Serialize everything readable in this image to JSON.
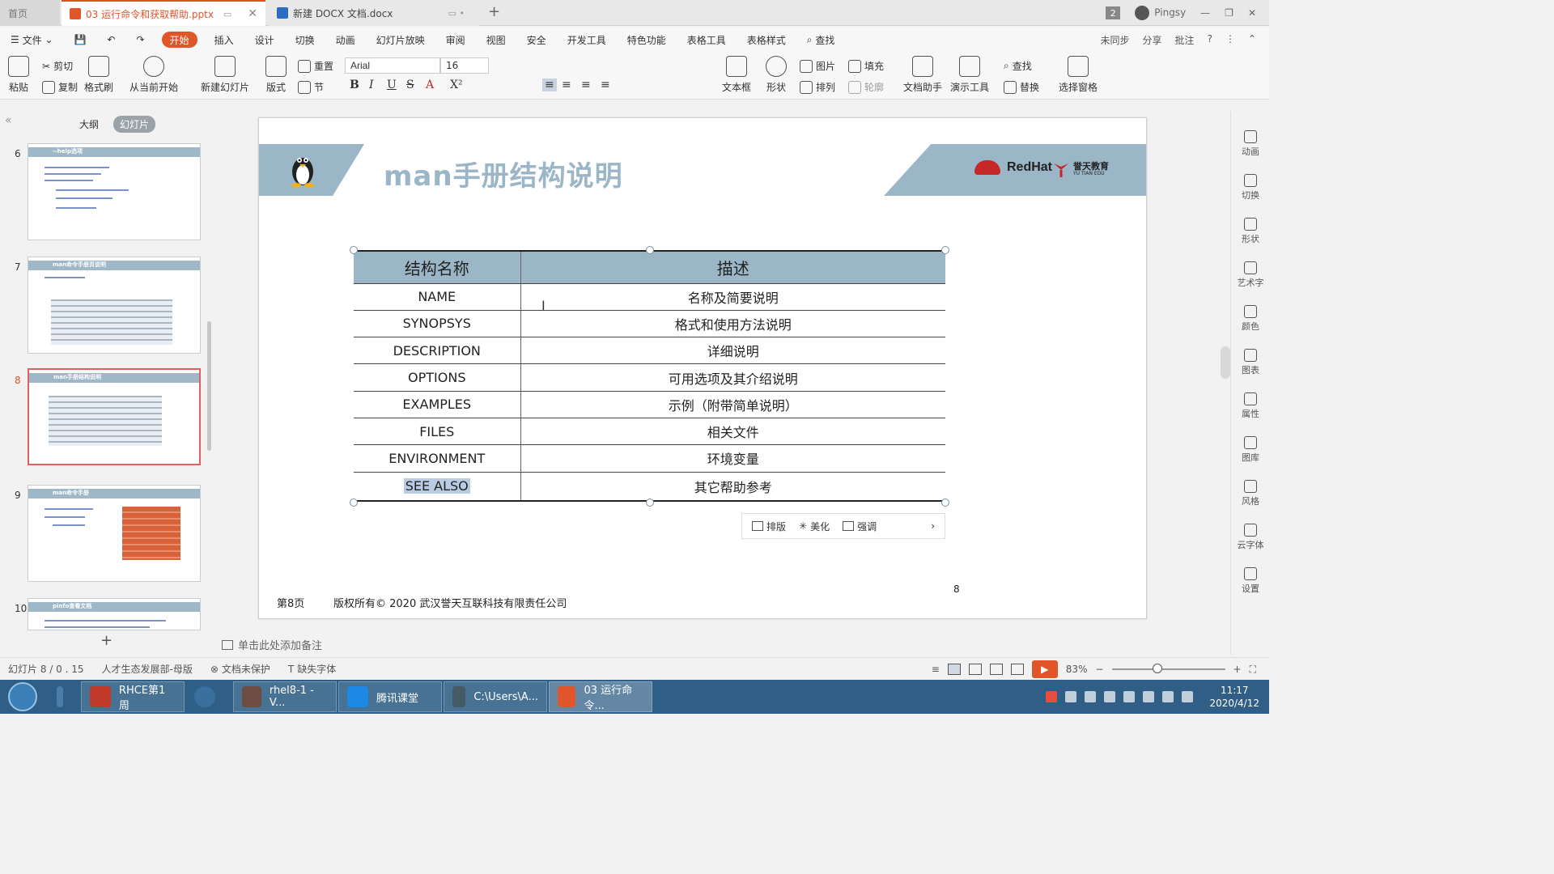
{
  "tabs": {
    "home": "首页",
    "active_doc": "03 运行命令和获取帮助.pptx",
    "second_doc": "新建 DOCX 文档.docx",
    "new_tab": "+",
    "user_name": "Pingsy",
    "window_count": "2"
  },
  "menu": {
    "file": "文件",
    "items": [
      "开始",
      "插入",
      "设计",
      "切换",
      "动画",
      "幻灯片放映",
      "审阅",
      "视图",
      "安全",
      "开发工具",
      "特色功能",
      "表格工具",
      "表格样式"
    ],
    "search": "查找",
    "right": [
      "未同步",
      "分享",
      "批注"
    ]
  },
  "ribbon": {
    "paste": "粘贴",
    "cut": "剪切",
    "copy": "复制",
    "format_painter": "格式刷",
    "from_current": "从当前开始",
    "new_slide": "新建幻灯片",
    "layout": "版式",
    "reset": "重置",
    "section": "节",
    "font_name": "Arial",
    "font_size": "16",
    "textbox": "文本框",
    "shape": "形状",
    "picture": "图片",
    "fill": "填充",
    "arrange": "排列",
    "outline": "轮廓",
    "doc_assistant": "文档助手",
    "present_tools": "演示工具",
    "find": "查找",
    "replace": "替换",
    "select_pane": "选择窗格"
  },
  "left_panel": {
    "tab_outline": "大纲",
    "tab_slides": "幻灯片",
    "slides": [
      {
        "num": "6",
        "title": "--help选项"
      },
      {
        "num": "7",
        "title": "man命令手册页说明"
      },
      {
        "num": "8",
        "title": "man手册结构说明"
      },
      {
        "num": "9",
        "title": "man命令手册"
      },
      {
        "num": "10",
        "title": "pinfo查看文档"
      }
    ]
  },
  "slide": {
    "title": "man手册结构说明",
    "brand_redhat": "RedHat",
    "brand_yutian": "誉天教育",
    "brand_yutian_sub": "YU TIAN EDU",
    "table": {
      "headers": [
        "结构名称",
        "描述"
      ],
      "rows": [
        [
          "NAME",
          "名称及简要说明"
        ],
        [
          "SYNOPSYS",
          "格式和使用方法说明"
        ],
        [
          "DESCRIPTION",
          "详细说明"
        ],
        [
          "OPTIONS",
          "可用选项及其介绍说明"
        ],
        [
          "EXAMPLES",
          "示例（附带简单说明）"
        ],
        [
          "FILES",
          "相关文件"
        ],
        [
          "ENVIRONMENT",
          "环境变量"
        ],
        [
          "SEE ALSO",
          "其它帮助参考"
        ]
      ]
    },
    "minibar": [
      "排版",
      "美化",
      "强调"
    ],
    "footer_page": "第8页",
    "footer_copyright": "版权所有© 2020 武汉誉天互联科技有限责任公司",
    "page_number": "8"
  },
  "notes_placeholder": "单击此处添加备注",
  "right_sidebar": [
    "动画",
    "切换",
    "形状",
    "艺术字",
    "颜色",
    "图表",
    "属性",
    "图库",
    "风格",
    "云字体",
    "设置"
  ],
  "status": {
    "slide_pos": "幻灯片 8 / 0 . 15",
    "template": "人才生态发展部-母版",
    "protect": "文档未保护",
    "missing_font": "缺失字体",
    "zoom": "83%"
  },
  "taskbar": {
    "apps": [
      "RHCE第1周",
      "rhel8-1 - V...",
      "腾讯课堂",
      "C:\\Users\\A...",
      "03 运行命令..."
    ],
    "time": "11:17",
    "date": "2020/4/12"
  }
}
